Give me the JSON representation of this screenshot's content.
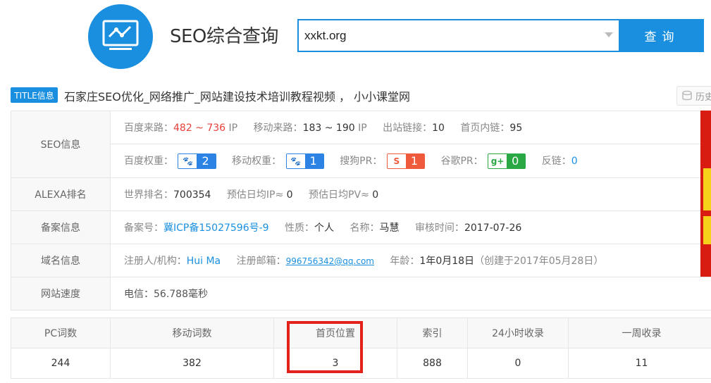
{
  "header": {
    "site_title": "SEO综合查询",
    "search_value": "xxkt.org",
    "search_button": "查询"
  },
  "title_line": {
    "tag": "TITLE信息",
    "text": "石家庄SEO优化_网络推广_网站建设技术培训教程视频 ， 小小课堂网",
    "history_label": "历史"
  },
  "seo_info": {
    "label": "SEO信息",
    "baidu_traffic_label": "百度来路：",
    "baidu_traffic_value": "482 ~ 736",
    "baidu_traffic_unit": "IP",
    "mobile_traffic_label": "移动来路：",
    "mobile_traffic_value": "183 ~ 190",
    "mobile_traffic_unit": "IP",
    "outlinks_label": "出站链接：",
    "outlinks_value": "10",
    "homepage_links_label": "首页内链：",
    "homepage_links_value": "95",
    "baidu_weight_label": "百度权重：",
    "baidu_weight_value": "2",
    "mobile_weight_label": "移动权重：",
    "mobile_weight_value": "1",
    "sogou_pr_label": "搜狗PR：",
    "sogou_pr_value": "1",
    "google_pr_label": "谷歌PR：",
    "google_pr_value": "0",
    "backlinks_label": "反链：",
    "backlinks_value": "0"
  },
  "alexa": {
    "label": "ALEXA排名",
    "world_rank_label": "世界排名：",
    "world_rank_value": "700354",
    "daily_ip_label": "预估日均IP≈",
    "daily_ip_value": "0",
    "daily_pv_label": "预估日均PV≈",
    "daily_pv_value": "0"
  },
  "icp": {
    "label": "备案信息",
    "number_label": "备案号：",
    "number_value": "冀ICP备15027596号-9",
    "nature_label": "性质：",
    "nature_value": "个人",
    "name_label": "名称：",
    "name_value": "马慧",
    "audit_label": "审核时间：",
    "audit_value": "2017-07-26"
  },
  "domain": {
    "label": "域名信息",
    "registrant_label": "注册人/机构：",
    "registrant_value": "Hui Ma",
    "email_label": "注册邮箱：",
    "email_value": "996756342@qq.com",
    "age_label": "年龄：",
    "age_value": "1年0月18日",
    "created_value": "（创建于2017年05月28日）"
  },
  "speed": {
    "label": "网站速度",
    "value": "电信：56.788毫秒"
  },
  "stats": {
    "headers": [
      "PC词数",
      "移动词数",
      "首页位置",
      "索引",
      "24小时收录",
      "一周收录"
    ],
    "values": [
      "244",
      "382",
      "3",
      "888",
      "0",
      "11"
    ]
  },
  "colors": {
    "accent": "#1a8fe0",
    "highlight_box": "#e4221c",
    "traffic_red": "#e8413b"
  }
}
